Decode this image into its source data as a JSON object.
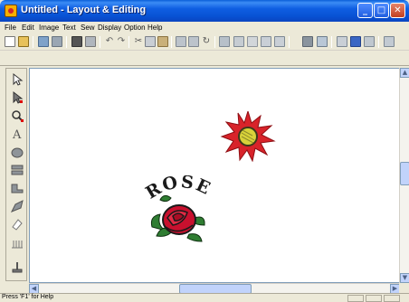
{
  "window": {
    "title": "Untitled - Layout & Editing",
    "min_glyph": "_",
    "max_glyph": "□",
    "close_glyph": "✕"
  },
  "menu": [
    "File",
    "Edit",
    "Image",
    "Text",
    "Sew",
    "Display",
    "Option",
    "Help"
  ],
  "toolbar_icons": [
    "new-icon",
    "open-icon",
    "save-icon",
    "import-icon",
    "print-icon",
    "undo-icon",
    "redo-icon",
    "cut-icon",
    "copy-icon",
    "paste-icon",
    "mirror-icon",
    "rotate-icon",
    "sew-icon",
    "fill-icon",
    "text-icon",
    "settings-icon",
    "preview-icon",
    "zoom-icon",
    "help-icon"
  ],
  "toolbox_icons": [
    "select-arrow-icon",
    "point-edit-icon",
    "zoom-tool-icon",
    "text-tool-icon",
    "circle-tool-icon",
    "shape-tool-icon",
    "line-tool-icon",
    "brush-tool-icon",
    "eraser-tool-icon",
    "stitch-tool-icon",
    "stamp-tool-icon"
  ],
  "canvas": {
    "rose_text": "ROSE"
  },
  "scrollbar": {
    "up": "▲",
    "down": "▼",
    "left": "◀",
    "right": "▶"
  },
  "status": {
    "help_text": "Press 'F1' for Help"
  },
  "colors": {
    "title_blue": "#0a5fd8",
    "sun_red": "#d8232a",
    "sun_center": "#d8d23a",
    "rose_red": "#c8102e",
    "leaf_green": "#2f7d32",
    "text_dark": "#1a1a1a"
  }
}
